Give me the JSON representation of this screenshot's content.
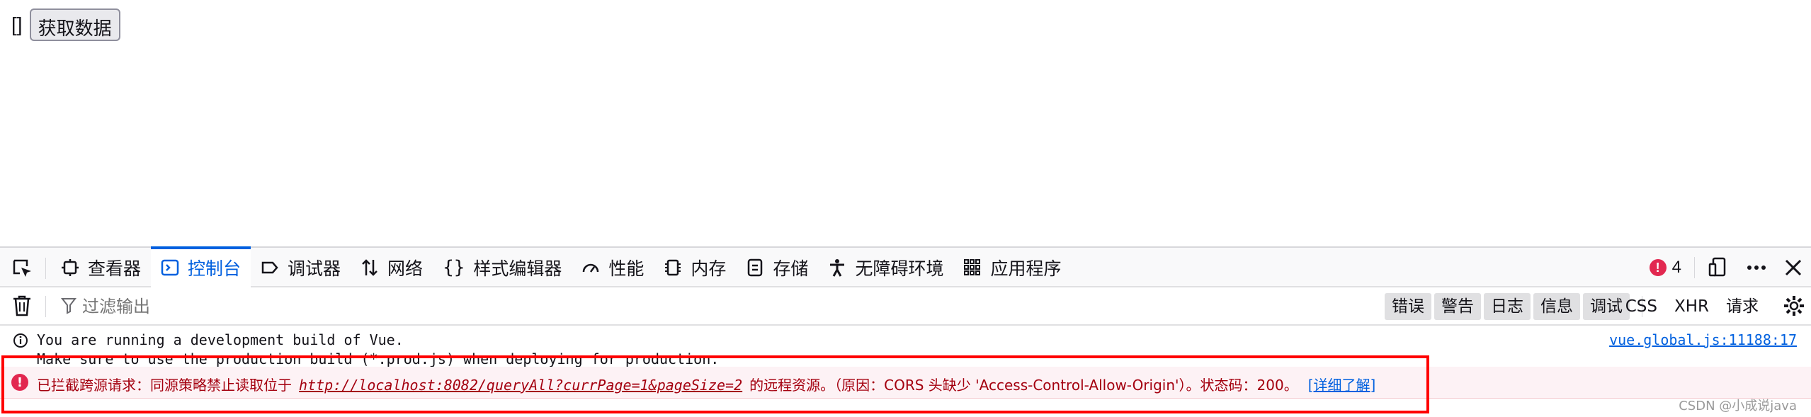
{
  "page": {
    "array_text": "[]",
    "fetch_button": "获取数据"
  },
  "devtools": {
    "tabs": [
      {
        "label": "查看器",
        "icon": "inspector-icon"
      },
      {
        "label": "控制台",
        "icon": "console-icon",
        "active": true
      },
      {
        "label": "调试器",
        "icon": "debugger-icon"
      },
      {
        "label": "网络",
        "icon": "network-icon"
      },
      {
        "label": "样式编辑器",
        "icon": "style-editor-icon"
      },
      {
        "label": "性能",
        "icon": "performance-icon"
      },
      {
        "label": "内存",
        "icon": "memory-icon"
      },
      {
        "label": "存储",
        "icon": "storage-icon"
      },
      {
        "label": "无障碍环境",
        "icon": "accessibility-icon"
      },
      {
        "label": "应用程序",
        "icon": "application-icon"
      }
    ],
    "error_count": "4",
    "filter_placeholder": "过滤输出",
    "levels": [
      "错误",
      "警告",
      "日志",
      "信息",
      "调试"
    ],
    "kinds": [
      "CSS",
      "XHR",
      "请求"
    ]
  },
  "console": {
    "info_line1": "You are running a development build of Vue.",
    "info_line2": "Make sure to use the production build (*.prod.js) when deploying for production.",
    "info_source": "vue.global.js:11188:17",
    "error_prefix": "已拦截跨源请求：同源策略禁止读取位于",
    "error_url": "http://localhost:8082/queryAll?currPage=1&pageSize=2",
    "error_suffix": "的远程资源。（原因：CORS 头缺少 'Access-Control-Allow-Origin'）。状态码：200。",
    "learn_more": "[详细了解]"
  },
  "watermark": "CSDN @小成说java",
  "colors": {
    "accent": "#0060df",
    "error_text": "#a4000f",
    "error_bg": "#fdf2f5",
    "highlight_box": "#ff0000"
  }
}
